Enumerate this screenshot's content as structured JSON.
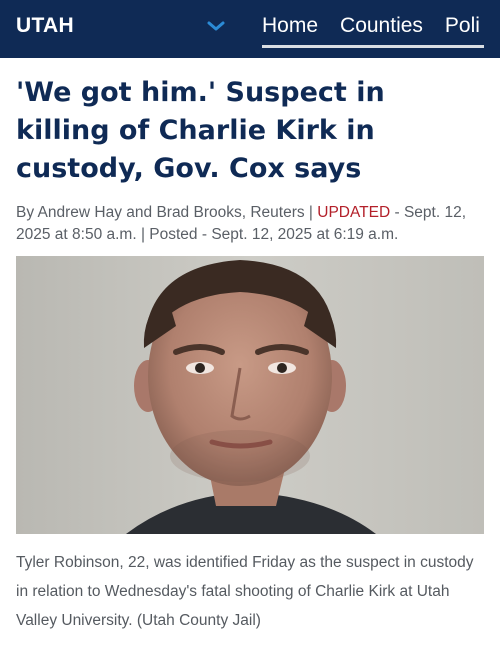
{
  "header": {
    "brand": "UTAH",
    "nav": [
      "Home",
      "Counties",
      "Poli"
    ],
    "colors": {
      "background": "#0f2a55",
      "accent": "#2b8bd6"
    },
    "menu_icon": "chevron-down-icon"
  },
  "article": {
    "headline": "'We got him.' Suspect in killing of Charlie Kirk in custody, Gov. Cox says",
    "byline": {
      "authors": "By Andrew Hay and Brad Brooks, Reuters |",
      "updated_label": "UPDATED",
      "updated_time": "- Sept. 12, 2025 at 8:50 a.m. |",
      "posted": "Posted - Sept. 12, 2025 at 6:19 a.m."
    },
    "caption": "Tyler Robinson, 22, was identified Friday as the suspect in custody in relation to Wednesday's fatal shooting of Charlie Kirk at Utah Valley University. (Utah County Jail)"
  }
}
